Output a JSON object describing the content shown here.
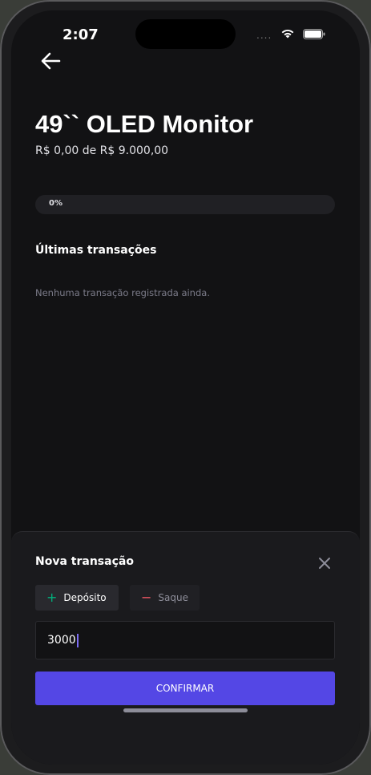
{
  "status_bar": {
    "time": "2:07",
    "signal": "....",
    "icons": [
      "wifi-icon",
      "battery-icon"
    ]
  },
  "header": {
    "back_icon": "arrow-left-icon"
  },
  "goal": {
    "title": "49`` OLED Monitor",
    "amount_text": "R$ 0,00 de R$ 9.000,00",
    "progress_label": "0%",
    "progress_fraction": 0
  },
  "transactions": {
    "title": "Últimas transações",
    "empty_text": "Nenhuma transação registrada ainda."
  },
  "sheet": {
    "title": "Nova transação",
    "close_icon": "close-icon",
    "deposit_label": "Depósito",
    "withdraw_label": "Saque",
    "amount_value": "3000",
    "confirm_label": "CONFIRMAR"
  },
  "colors": {
    "accent": "#5447e5",
    "deposit": "#00b37e",
    "withdraw": "#f75a68",
    "background": "#121214"
  }
}
